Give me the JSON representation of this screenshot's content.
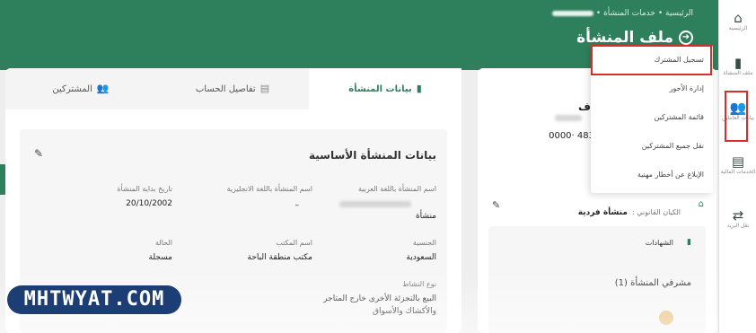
{
  "breadcrumb": {
    "home": "الرئيسية",
    "sep": "•",
    "services": "خدمات المنشأة"
  },
  "page": {
    "title": "ملف المنشأة",
    "title_icon": "arrow-circle-icon"
  },
  "sidebar": [
    {
      "label": "الرئيسية",
      "icon": "home-icon",
      "glyph": "⌂"
    },
    {
      "label": "ملف المنشأة",
      "icon": "building-icon",
      "glyph": "▮"
    },
    {
      "label": "بيانات العاملين",
      "icon": "users-icon",
      "glyph": "👥"
    },
    {
      "label": "الخدمات المالية",
      "icon": "document-icon",
      "glyph": "▤"
    },
    {
      "label": "نقل البريد",
      "icon": "transfer-arrows-icon",
      "glyph": "⇄"
    }
  ],
  "tabs": [
    {
      "label": "بيانات المنشأة",
      "icon": "file-icon"
    },
    {
      "label": "تفاصيل الحساب",
      "icon": "file-icon"
    },
    {
      "label": "المشتركين",
      "icon": "users-icon"
    }
  ],
  "section": {
    "title": "بيانات المنشأة الأساسية",
    "fields": {
      "name_ar_label": "اسم المنشأة باللغة العربية",
      "name_ar_value": "منشأة",
      "name_en_label": "اسم المنشأة باللغة الانجليزية",
      "name_en_value": "–",
      "start_date_label": "تاريخ بداية المنشأة",
      "start_date_value": "20/10/2002",
      "nationality_label": "الجنسية",
      "nationality_value": "السعودية",
      "office_label": "اسم المكتب",
      "office_value": "مكتب منطقة الباحة",
      "status_label": "الحالة",
      "status_value": "مسجلة",
      "activity_label": "نوع النشاط",
      "activity_value_1": "البيع بالتجزئة الأخرى خارج المتاجر",
      "activity_value_2": "والأكشاك والأسواق"
    }
  },
  "card2": {
    "number_partial": "483 ·0000",
    "name_partial": "ف"
  },
  "card3": {
    "legal_label": "الكيان القانوني :",
    "legal_value": "منشأة فردية",
    "certificates": "الشهادات",
    "supervisors": "مشرفي المنشأة (1)"
  },
  "dropdown": [
    "تسجيل المشترك",
    "إدارة الأجور",
    "قائمة المشتركين",
    "نقل جميع المشتركين",
    "الإبلاغ عن أخطار مهنية"
  ],
  "watermark": "MHTWYAT.COM",
  "colors": {
    "brand_green": "#2e7f5c",
    "highlight_red": "#d92c2c",
    "watermark_blue": "#1d3e74"
  }
}
